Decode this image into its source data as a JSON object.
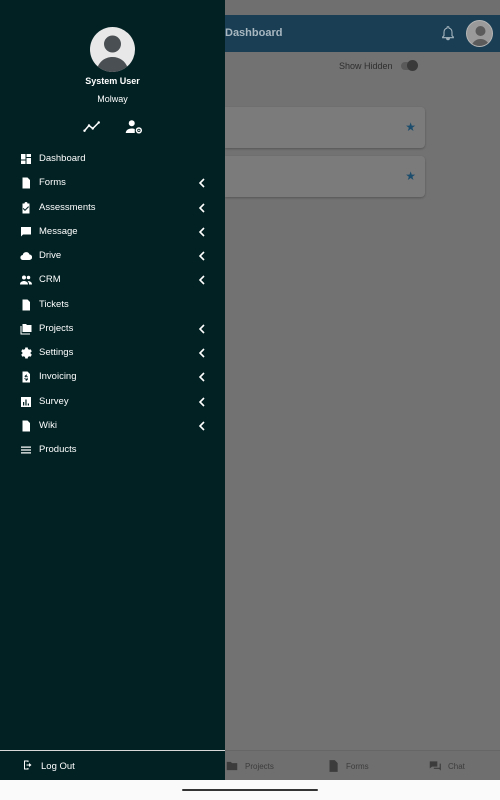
{
  "app_bar": {
    "title": "Dashboard"
  },
  "main": {
    "show_hidden_label": "Show Hidden",
    "card_star": "★"
  },
  "bottom_nav": [
    {
      "label": "Projects",
      "icon": "folder-icon"
    },
    {
      "label": "Forms",
      "icon": "document-icon"
    },
    {
      "label": "Chat",
      "icon": "chat-bubbles-icon"
    }
  ],
  "drawer": {
    "user_name": "System User",
    "organization": "Molway",
    "quick_actions": [
      {
        "icon": "activity-trend-icon"
      },
      {
        "icon": "user-settings-icon"
      }
    ],
    "menu": [
      {
        "label": "Dashboard",
        "icon": "dashboard-icon",
        "has_submenu": false
      },
      {
        "label": "Forms",
        "icon": "document-icon",
        "has_submenu": true
      },
      {
        "label": "Assessments",
        "icon": "clipboard-check-icon",
        "has_submenu": true
      },
      {
        "label": "Message",
        "icon": "message-icon",
        "has_submenu": true
      },
      {
        "label": "Drive",
        "icon": "cloud-icon",
        "has_submenu": true
      },
      {
        "label": "CRM",
        "icon": "people-icon",
        "has_submenu": true
      },
      {
        "label": "Tickets",
        "icon": "ticket-icon",
        "has_submenu": false
      },
      {
        "label": "Projects",
        "icon": "folders-icon",
        "has_submenu": true
      },
      {
        "label": "Settings",
        "icon": "gear-icon",
        "has_submenu": true
      },
      {
        "label": "Invoicing",
        "icon": "invoice-icon",
        "has_submenu": true
      },
      {
        "label": "Survey",
        "icon": "bar-chart-icon",
        "has_submenu": true
      },
      {
        "label": "Wiki",
        "icon": "wiki-document-icon",
        "has_submenu": true
      },
      {
        "label": "Products",
        "icon": "list-icon",
        "has_submenu": false
      }
    ],
    "logout_label": "Log Out"
  }
}
